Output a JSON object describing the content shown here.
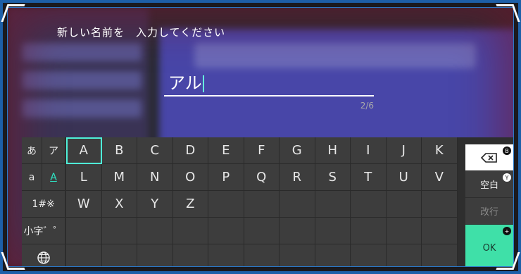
{
  "header": {
    "title": "新しい名前を　入力してください"
  },
  "input": {
    "value": "アル",
    "counter": "2/6"
  },
  "keyboard": {
    "mode_keys": [
      {
        "label": "あ"
      },
      {
        "label": "ア"
      },
      {
        "label": "a"
      },
      {
        "label": "A"
      },
      {
        "label": "1#※"
      },
      {
        "label": "小字゛゜"
      }
    ],
    "rows": [
      [
        "A",
        "B",
        "C",
        "D",
        "E",
        "F",
        "G",
        "H",
        "I",
        "J",
        "K"
      ],
      [
        "L",
        "M",
        "N",
        "O",
        "P",
        "Q",
        "R",
        "S",
        "T",
        "U",
        "V"
      ],
      [
        "W",
        "X",
        "Y",
        "Z"
      ]
    ],
    "backspace": {
      "badge": "B"
    },
    "space": {
      "label": "空白",
      "badge": "Y"
    },
    "newline": {
      "label": "改行"
    },
    "ok": {
      "label": "OK",
      "badge": "+"
    }
  },
  "colors": {
    "accent": "#2ee4c4",
    "ok_bg": "#3fe0a8",
    "frame": "#1d5fa8"
  }
}
